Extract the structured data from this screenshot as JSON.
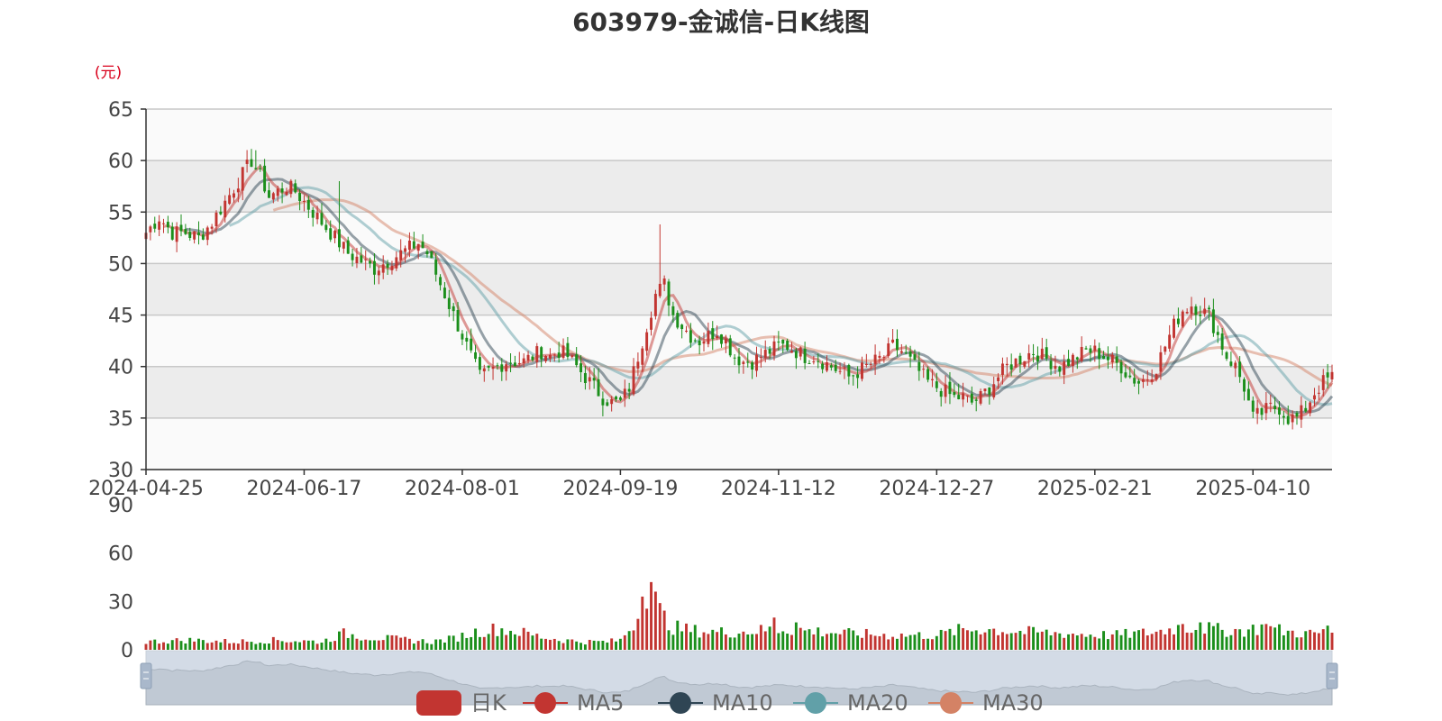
{
  "chart_data": {
    "type": "candlestick",
    "title": "603979-金诚信-日K线图",
    "unit": "(元)",
    "price_axis": {
      "min": 30,
      "max": 65,
      "ticks": [
        "30",
        "35",
        "40",
        "45",
        "50",
        "55",
        "60",
        "65"
      ]
    },
    "volume_axis": {
      "min": 0,
      "max": 90,
      "ticks": [
        "0",
        "30",
        "60",
        "90"
      ]
    },
    "x_ticks": [
      "2024-04-25",
      "2024-06-17",
      "2024-08-01",
      "2024-09-19",
      "2024-11-12",
      "2024-12-27",
      "2025-02-21",
      "2025-04-10"
    ],
    "x_tick_index": [
      0,
      36,
      72,
      108,
      144,
      180,
      216,
      252
    ],
    "price_anchors": [
      [
        0,
        53
      ],
      [
        3,
        54.5
      ],
      [
        6,
        53
      ],
      [
        9,
        53
      ],
      [
        12,
        52.5
      ],
      [
        15,
        54
      ],
      [
        18,
        56
      ],
      [
        21,
        58
      ],
      [
        24,
        60
      ],
      [
        26,
        58.5
      ],
      [
        28,
        56.5
      ],
      [
        30,
        57
      ],
      [
        32,
        57.5
      ],
      [
        34,
        57
      ],
      [
        36,
        56
      ],
      [
        38,
        55
      ],
      [
        40,
        54
      ],
      [
        42,
        53
      ],
      [
        44,
        52
      ],
      [
        46,
        51
      ],
      [
        48,
        50.5
      ],
      [
        50,
        50
      ],
      [
        52,
        49.5
      ],
      [
        54,
        50
      ],
      [
        56,
        50.5
      ],
      [
        58,
        51
      ],
      [
        60,
        51.5
      ],
      [
        62,
        52
      ],
      [
        64,
        51
      ],
      [
        66,
        49
      ],
      [
        68,
        47
      ],
      [
        70,
        45
      ],
      [
        72,
        43
      ],
      [
        74,
        41
      ],
      [
        76,
        39
      ],
      [
        78,
        39.5
      ],
      [
        80,
        40
      ],
      [
        82,
        40.5
      ],
      [
        84,
        40.5
      ],
      [
        86,
        40.5
      ],
      [
        88,
        41
      ],
      [
        90,
        41.5
      ],
      [
        92,
        41
      ],
      [
        94,
        41.5
      ],
      [
        96,
        41
      ],
      [
        98,
        40
      ],
      [
        100,
        39
      ],
      [
        102,
        38
      ],
      [
        104,
        37
      ],
      [
        106,
        36.5
      ],
      [
        108,
        36.5
      ],
      [
        110,
        38
      ],
      [
        112,
        41
      ],
      [
        114,
        44
      ],
      [
        116,
        47
      ],
      [
        118,
        48
      ],
      [
        120,
        45
      ],
      [
        122,
        44
      ],
      [
        124,
        43
      ],
      [
        126,
        42.5
      ],
      [
        128,
        43
      ],
      [
        130,
        43.5
      ],
      [
        132,
        42.5
      ],
      [
        134,
        41
      ],
      [
        136,
        40.5
      ],
      [
        138,
        40.5
      ],
      [
        140,
        41
      ],
      [
        142,
        41.5
      ],
      [
        144,
        42
      ],
      [
        146,
        42
      ],
      [
        148,
        41.5
      ],
      [
        150,
        41
      ],
      [
        152,
        41
      ],
      [
        154,
        40.5
      ],
      [
        156,
        40
      ],
      [
        158,
        39.5
      ],
      [
        160,
        39
      ],
      [
        162,
        39.5
      ],
      [
        164,
        40
      ],
      [
        166,
        40.5
      ],
      [
        168,
        41
      ],
      [
        170,
        42
      ],
      [
        172,
        41.5
      ],
      [
        174,
        40.5
      ],
      [
        176,
        39.5
      ],
      [
        178,
        38.5
      ],
      [
        180,
        38
      ],
      [
        182,
        37.5
      ],
      [
        184,
        37
      ],
      [
        186,
        37
      ],
      [
        188,
        36.5
      ],
      [
        190,
        37
      ],
      [
        192,
        38
      ],
      [
        194,
        39
      ],
      [
        196,
        40
      ],
      [
        198,
        40.5
      ],
      [
        200,
        41
      ],
      [
        202,
        41.5
      ],
      [
        204,
        41
      ],
      [
        206,
        40.5
      ],
      [
        208,
        40
      ],
      [
        210,
        40.5
      ],
      [
        212,
        41
      ],
      [
        214,
        41.5
      ],
      [
        216,
        41.5
      ],
      [
        218,
        41
      ],
      [
        220,
        40.5
      ],
      [
        222,
        40
      ],
      [
        224,
        39
      ],
      [
        226,
        38.5
      ],
      [
        228,
        39
      ],
      [
        230,
        40
      ],
      [
        232,
        42
      ],
      [
        234,
        44
      ],
      [
        236,
        45.5
      ],
      [
        238,
        46
      ],
      [
        240,
        45.5
      ],
      [
        242,
        45
      ],
      [
        244,
        43
      ],
      [
        246,
        41
      ],
      [
        248,
        40
      ],
      [
        250,
        38
      ],
      [
        252,
        35
      ],
      [
        254,
        35.5
      ],
      [
        256,
        36
      ],
      [
        258,
        36
      ],
      [
        260,
        35
      ],
      [
        262,
        35
      ],
      [
        264,
        36
      ],
      [
        266,
        37.5
      ],
      [
        268,
        38.5
      ],
      [
        270,
        39
      ]
    ],
    "volume_anchors": [
      [
        0,
        5
      ],
      [
        10,
        6
      ],
      [
        20,
        5
      ],
      [
        30,
        6
      ],
      [
        40,
        5
      ],
      [
        45,
        10
      ],
      [
        50,
        8
      ],
      [
        55,
        7
      ],
      [
        60,
        6
      ],
      [
        65,
        5
      ],
      [
        70,
        7
      ],
      [
        75,
        11
      ],
      [
        80,
        13
      ],
      [
        85,
        11
      ],
      [
        90,
        8
      ],
      [
        95,
        6
      ],
      [
        100,
        5
      ],
      [
        105,
        5
      ],
      [
        108,
        6
      ],
      [
        112,
        20
      ],
      [
        114,
        38
      ],
      [
        116,
        30
      ],
      [
        118,
        20
      ],
      [
        120,
        14
      ],
      [
        124,
        12
      ],
      [
        130,
        11
      ],
      [
        135,
        11
      ],
      [
        140,
        12
      ],
      [
        145,
        13
      ],
      [
        150,
        12
      ],
      [
        160,
        10
      ],
      [
        170,
        9
      ],
      [
        180,
        9
      ],
      [
        185,
        12
      ],
      [
        190,
        13
      ],
      [
        195,
        12
      ],
      [
        200,
        11
      ],
      [
        210,
        10
      ],
      [
        220,
        9
      ],
      [
        230,
        11
      ],
      [
        235,
        14
      ],
      [
        240,
        14
      ],
      [
        245,
        12
      ],
      [
        250,
        12
      ],
      [
        255,
        14
      ],
      [
        260,
        11
      ],
      [
        265,
        10
      ],
      [
        270,
        11
      ]
    ],
    "volume_spikes": [
      [
        115,
        42
      ],
      [
        113,
        33
      ],
      [
        117,
        29
      ],
      [
        143,
        20
      ],
      [
        148,
        17
      ],
      [
        236,
        16
      ],
      [
        240,
        17
      ],
      [
        255,
        16
      ],
      [
        269,
        15
      ]
    ],
    "price_spikes": [
      [
        117,
        53.8
      ],
      [
        25,
        61
      ],
      [
        44,
        58
      ]
    ],
    "count": 271,
    "series": [
      {
        "name": "日K",
        "color": "#c23531"
      },
      {
        "name": "MA5",
        "color": "#c23531"
      },
      {
        "name": "MA10",
        "color": "#2f4554"
      },
      {
        "name": "MA20",
        "color": "#61a0a8"
      },
      {
        "name": "MA30",
        "color": "#d48265"
      }
    ],
    "colors": {
      "up": "#c23531",
      "down": "#1b8f1b"
    }
  }
}
